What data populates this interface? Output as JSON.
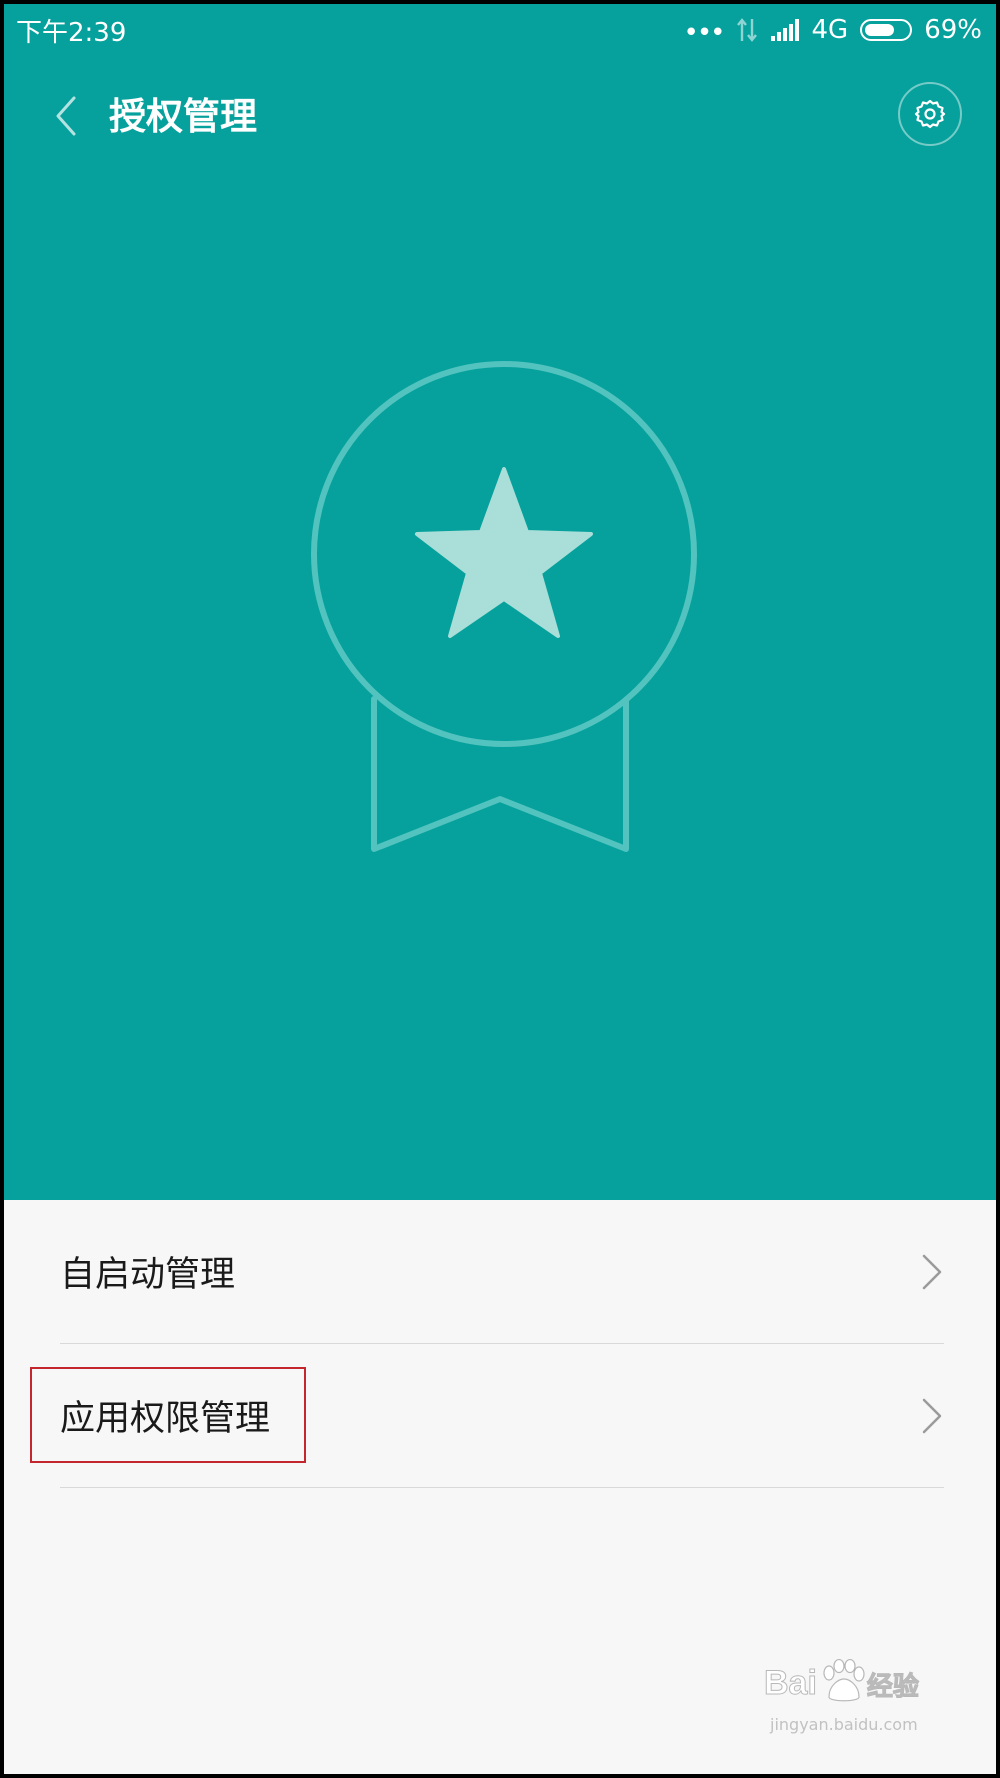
{
  "status_bar": {
    "time": "下午2:39",
    "signal_dots": "•••",
    "network": "4G",
    "battery_percent": "69%",
    "battery_level": 0.69
  },
  "header": {
    "title": "授权管理",
    "back_icon": "chevron-left-icon",
    "settings_icon": "gear-icon"
  },
  "hero": {
    "illustration": "medal-star-icon",
    "background_color": "#06a19c"
  },
  "list": {
    "items": [
      {
        "label": "自启动管理"
      },
      {
        "label": "应用权限管理"
      }
    ]
  },
  "colors": {
    "accent": "#06a19c",
    "highlight": "#c4262e",
    "list_bg": "#f7f7f7"
  },
  "watermark": {
    "brand": "Bai",
    "brand_cn": "经验",
    "url": "jingyan.baidu.com"
  }
}
